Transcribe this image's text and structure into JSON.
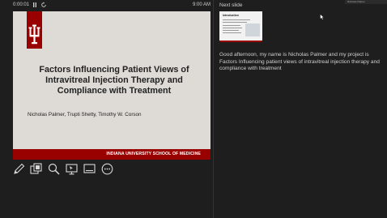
{
  "topbar": {
    "timer": "0:00:01",
    "clock": "9:00 AM",
    "pause_icon": "pause-icon",
    "restart_icon": "restart-icon"
  },
  "slide": {
    "title": "Factors Influencing Patient Views of Intravitreal Injection Therapy and Compliance with Treatment",
    "authors": "Nicholas Palmer, Trupti Shetty, Timothy W. Corson",
    "footer": "INDIANA UNIVERSITY SCHOOL OF MEDICINE",
    "brand_color": "#990000",
    "background_color": "#dedbd6",
    "logo": "iu-trident-logo"
  },
  "toolbar": {
    "icons": [
      "pen-icon",
      "slides-grid-icon",
      "zoom-icon",
      "pointer-screen-icon",
      "subtitles-icon",
      "more-options-icon"
    ]
  },
  "next_slide": {
    "label": "Next slide",
    "thumbnail_title": "Introduction"
  },
  "notes": {
    "text": "Good afternoon, my name is Nicholas Palmer and my project is Factors Influencing patient views of intravitreal injection therapy and compliance with treatment"
  },
  "profile": {
    "name": "Nicholas Palmer"
  }
}
